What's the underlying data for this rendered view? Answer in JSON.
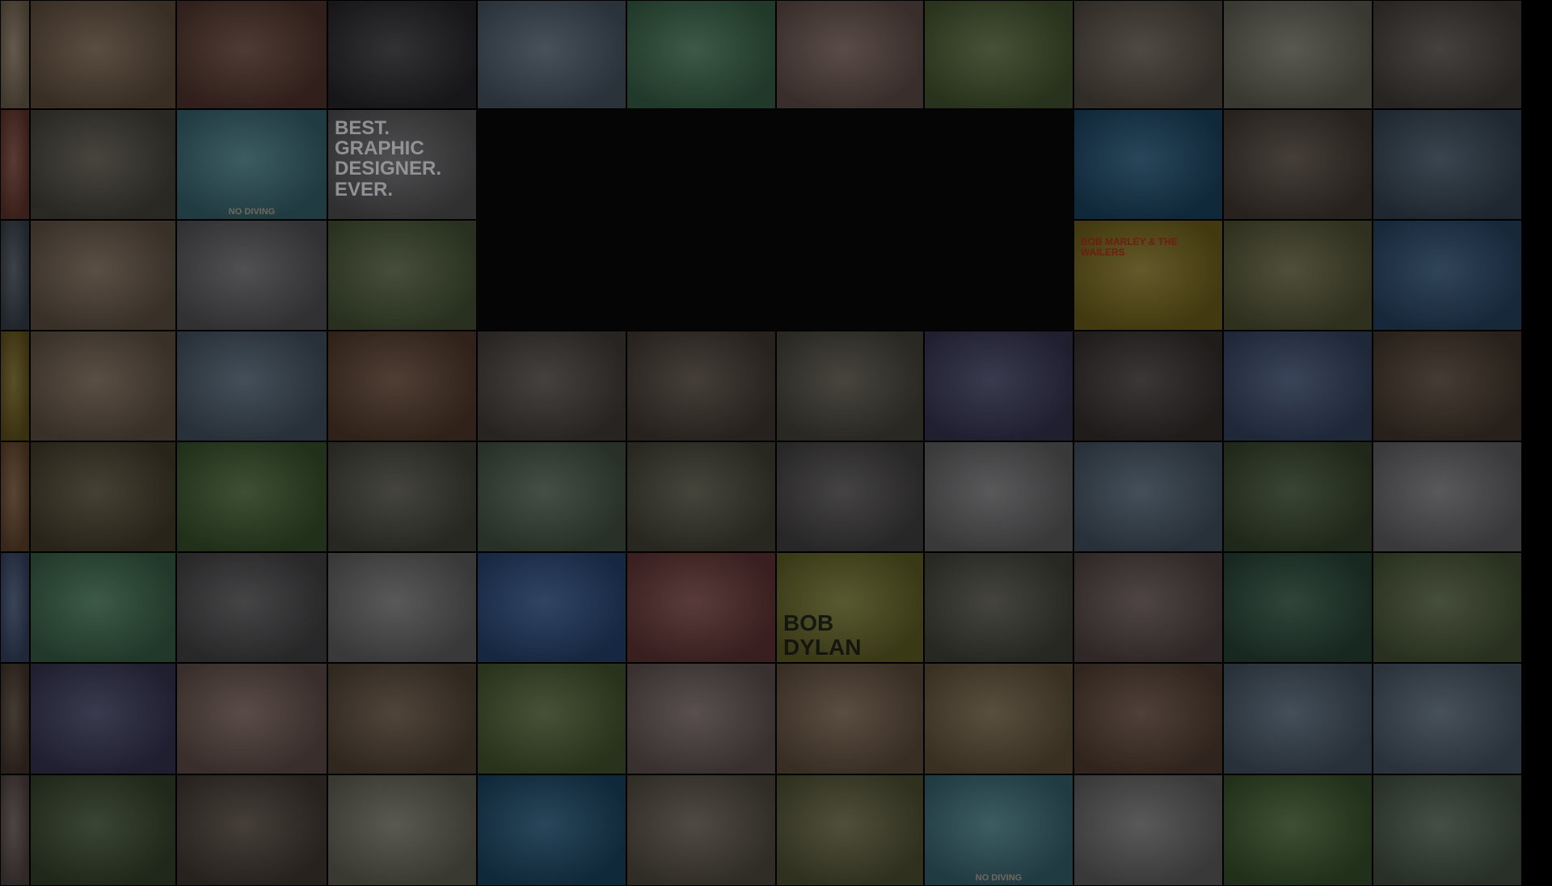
{
  "background": "#000000",
  "void_color": "#070708",
  "tiles": [
    {
      "row": 0,
      "col": 0,
      "subject": "tools-rack",
      "color": "#7a6a56"
    },
    {
      "row": 0,
      "col": 1,
      "subject": "djembe-drums",
      "color": "#6b5744"
    },
    {
      "row": 0,
      "col": 2,
      "subject": "garden-gnomes",
      "color": "#5a3a32"
    },
    {
      "row": 0,
      "col": 3,
      "subject": "band-guitarist",
      "color": "#2c2c30"
    },
    {
      "row": 0,
      "col": 4,
      "subject": "beach-house",
      "color": "#4e5d6c"
    },
    {
      "row": 0,
      "col": 5,
      "subject": "tablet-device",
      "color": "#3d6a4e"
    },
    {
      "row": 0,
      "col": 6,
      "subject": "face-massage",
      "color": "#6a5550"
    },
    {
      "row": 0,
      "col": 7,
      "subject": "orange-chairs",
      "color": "#4c5e34"
    },
    {
      "row": 0,
      "col": 8,
      "subject": "street-trio",
      "color": "#5a5248"
    },
    {
      "row": 0,
      "col": 9,
      "subject": "patterned-mug",
      "color": "#6a6a5c"
    },
    {
      "row": 0,
      "col": 10,
      "subject": "black-heels",
      "color": "#4a4440"
    },
    {
      "row": 1,
      "col": 0,
      "subject": "hand-close",
      "color": "#6a3a30"
    },
    {
      "row": 1,
      "col": 1,
      "subject": "gold-bicycle",
      "color": "#4e4a40"
    },
    {
      "row": 1,
      "col": 2,
      "subject": "swimming-pool",
      "color": "#3c6e78",
      "caption": "NO DIVING"
    },
    {
      "row": 1,
      "col": 3,
      "subject": "graphic-designer-poster",
      "color": "#5a5a5c",
      "caption": "BEST. GRAPHIC DESIGNER. EVER."
    },
    {
      "row": 1,
      "col": 7,
      "subject": "acoustic-guitars",
      "color": "#4a4430"
    },
    {
      "row": 1,
      "col": 8,
      "subject": "scuba-diver",
      "color": "#1e4c6c"
    },
    {
      "row": 1,
      "col": 9,
      "subject": "bento-meals",
      "color": "#4a4038"
    },
    {
      "row": 1,
      "col": 10,
      "subject": "beach-shore",
      "color": "#3a4a5a"
    },
    {
      "row": 2,
      "col": 0,
      "subject": "yellow-car-edge",
      "color": "#3c4650"
    },
    {
      "row": 2,
      "col": 1,
      "subject": "swimsuit-dolls",
      "color": "#6a5a4a"
    },
    {
      "row": 2,
      "col": 2,
      "subject": "white-motorcycle",
      "color": "#5c5c60"
    },
    {
      "row": 2,
      "col": 3,
      "subject": "tie-dye-friends",
      "color": "#4c5a3a"
    },
    {
      "row": 2,
      "col": 7,
      "subject": "pack-of-dogs",
      "color": "#5a5448"
    },
    {
      "row": 2,
      "col": 8,
      "subject": "bob-marley-poster",
      "color": "#7a6a1e",
      "caption": "BOB MARLEY & THE WAILERS"
    },
    {
      "row": 2,
      "col": 9,
      "subject": "woven-rug",
      "color": "#5a5a3a"
    },
    {
      "row": 2,
      "col": 10,
      "subject": "blue-edge",
      "color": "#2a4a6a"
    },
    {
      "row": 3,
      "col": 0,
      "subject": "yellow-sign-edge",
      "color": "#6a5a1e"
    },
    {
      "row": 3,
      "col": 1,
      "subject": "dried-foods-grid",
      "color": "#6a5a4a"
    },
    {
      "row": 3,
      "col": 2,
      "subject": "fishing-woman",
      "color": "#4a5a6a"
    },
    {
      "row": 3,
      "col": 3,
      "subject": "espresso-machine",
      "color": "#5a4030"
    },
    {
      "row": 3,
      "col": 4,
      "subject": "black-heels",
      "color": "#4a4440"
    },
    {
      "row": 3,
      "col": 5,
      "subject": "bento-meals",
      "color": "#4a4038"
    },
    {
      "row": 3,
      "col": 6,
      "subject": "gold-bicycle",
      "color": "#4e4a40"
    },
    {
      "row": 3,
      "col": 7,
      "subject": "psychedelic-pattern",
      "color": "#3a3a5a"
    },
    {
      "row": 3,
      "col": 8,
      "subject": "man-with-camera",
      "color": "#3a3432"
    },
    {
      "row": 3,
      "col": 9,
      "subject": "soda-bottles",
      "color": "#3a4a6a"
    },
    {
      "row": 3,
      "col": 10,
      "subject": "calculator-hands",
      "color": "#4a3c30"
    },
    {
      "row": 4,
      "col": 0,
      "subject": "person-edge",
      "color": "#6a4a30"
    },
    {
      "row": 4,
      "col": 1,
      "subject": "acoustic-guitars",
      "color": "#4a4430"
    },
    {
      "row": 4,
      "col": 2,
      "subject": "red-kayak",
      "color": "#3e5a30"
    },
    {
      "row": 4,
      "col": 3,
      "subject": "blue-stroller",
      "color": "#4a4a40"
    },
    {
      "row": 4,
      "col": 4,
      "subject": "tutoring-pair",
      "color": "#4a5a4a"
    },
    {
      "row": 4,
      "col": 5,
      "subject": "surfboard",
      "color": "#4a4a3c"
    },
    {
      "row": 4,
      "col": 6,
      "subject": "beaded-necklace",
      "color": "#4a4848"
    },
    {
      "row": 4,
      "col": 7,
      "subject": "tool-wall",
      "color": "#6a6a6c"
    },
    {
      "row": 4,
      "col": 8,
      "subject": "mini-cooper",
      "color": "#4a5a6a"
    },
    {
      "row": 4,
      "col": 9,
      "subject": "horse-rider",
      "color": "#3a4a30"
    },
    {
      "row": 4,
      "col": 10,
      "subject": "laptop",
      "color": "#6a6a6e"
    },
    {
      "row": 5,
      "col": 0,
      "subject": "bottles-edge",
      "color": "#3a4a6a"
    },
    {
      "row": 5,
      "col": 1,
      "subject": "tablet-device",
      "color": "#3d6a4e"
    },
    {
      "row": 5,
      "col": 2,
      "subject": "turntable",
      "color": "#4a4a4c"
    },
    {
      "row": 5,
      "col": 3,
      "subject": "film-crew",
      "color": "#6a6a6a"
    },
    {
      "row": 5,
      "col": 4,
      "subject": "headphones",
      "color": "#2a4a7a"
    },
    {
      "row": 5,
      "col": 5,
      "subject": "scattered-postcards",
      "color": "#6a3a3a"
    },
    {
      "row": 5,
      "col": 6,
      "subject": "bob-dylan-poster",
      "color": "#6a6a2a",
      "caption": "BOB DYLAN"
    },
    {
      "row": 5,
      "col": 7,
      "subject": "market-vendors",
      "color": "#4a4a40"
    },
    {
      "row": 5,
      "col": 8,
      "subject": "decorated-cookies",
      "color": "#5a4a4a"
    },
    {
      "row": 5,
      "col": 9,
      "subject": "baseball-stadium",
      "color": "#2a4a3a"
    },
    {
      "row": 5,
      "col": 10,
      "subject": "tie-dye-friends",
      "color": "#4c5a3a"
    },
    {
      "row": 6,
      "col": 0,
      "subject": "brick-edge",
      "color": "#4a3a30"
    },
    {
      "row": 6,
      "col": 1,
      "subject": "psychedelic-pattern",
      "color": "#3a3a5a"
    },
    {
      "row": 6,
      "col": 2,
      "subject": "face-massage",
      "color": "#6a5550"
    },
    {
      "row": 6,
      "col": 3,
      "subject": "lego-bricks",
      "color": "#5a4a3a"
    },
    {
      "row": 6,
      "col": 4,
      "subject": "orange-chairs",
      "color": "#4c5e34"
    },
    {
      "row": 6,
      "col": 5,
      "subject": "makeup-face",
      "color": "#6a5a5a"
    },
    {
      "row": 6,
      "col": 6,
      "subject": "djembe-drums",
      "color": "#6b5744"
    },
    {
      "row": 6,
      "col": 7,
      "subject": "egg-basket",
      "color": "#6a5a40"
    },
    {
      "row": 6,
      "col": 8,
      "subject": "acupuncture-hand",
      "color": "#5a4438"
    },
    {
      "row": 6,
      "col": 9,
      "subject": "fishing-woman",
      "color": "#4a5a6a"
    },
    {
      "row": 6,
      "col": 10,
      "subject": "beach-house",
      "color": "#4e5d6c"
    },
    {
      "row": 7,
      "col": 0,
      "subject": "cookies-edge",
      "color": "#5a4a4a"
    },
    {
      "row": 7,
      "col": 1,
      "subject": "horse-rider",
      "color": "#3a4a30"
    },
    {
      "row": 7,
      "col": 2,
      "subject": "bento-meals",
      "color": "#4a4038"
    },
    {
      "row": 7,
      "col": 3,
      "subject": "patterned-mug",
      "color": "#6a6a5c"
    },
    {
      "row": 7,
      "col": 4,
      "subject": "scuba-diver",
      "color": "#1e4c6c"
    },
    {
      "row": 7,
      "col": 5,
      "subject": "pack-of-dogs",
      "color": "#5a5448"
    },
    {
      "row": 7,
      "col": 6,
      "subject": "woven-rug",
      "color": "#5a5a3a"
    },
    {
      "row": 7,
      "col": 7,
      "subject": "swimming-pool",
      "color": "#3c6e78",
      "caption": "NO DIVING"
    },
    {
      "row": 7,
      "col": 8,
      "subject": "film-crew",
      "color": "#6a6a6a"
    },
    {
      "row": 7,
      "col": 9,
      "subject": "red-kayak",
      "color": "#3e5a30"
    },
    {
      "row": 7,
      "col": 10,
      "subject": "tutoring-pair",
      "color": "#4a5a4a"
    }
  ]
}
